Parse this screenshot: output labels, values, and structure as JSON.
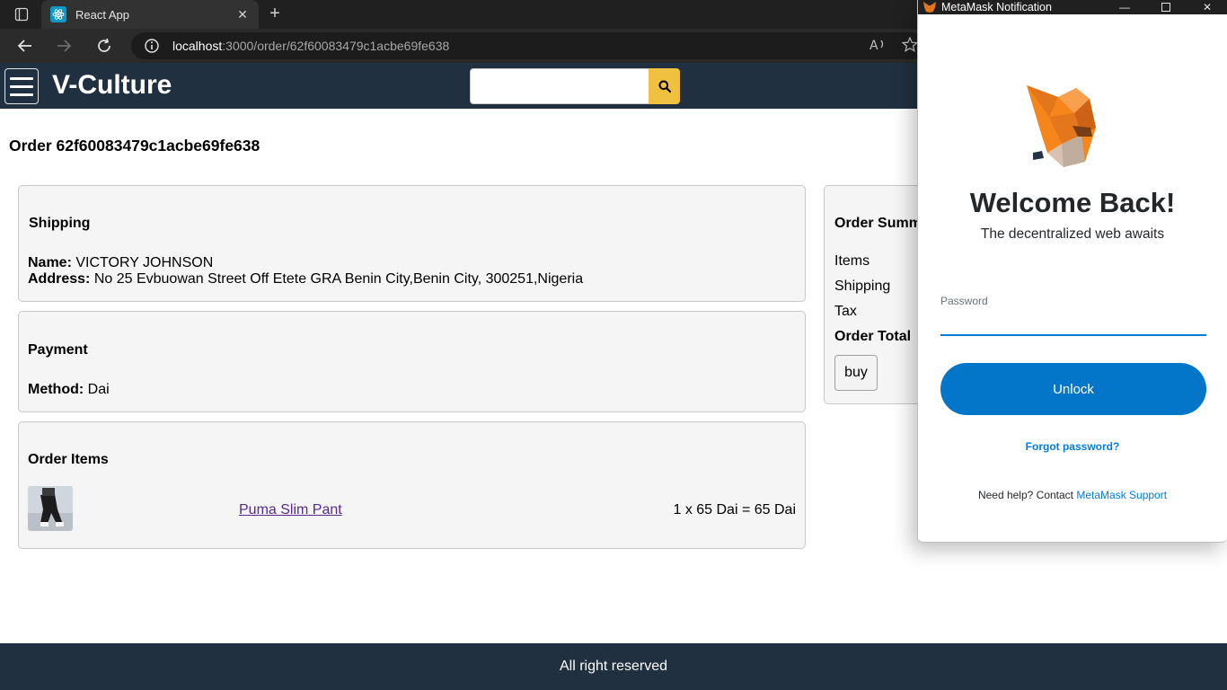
{
  "browser": {
    "tab_title": "React App",
    "url_host": "localhost",
    "url_path": ":3000/order/62f60083479c1acbe69fe638"
  },
  "header": {
    "brand": "V-Culture",
    "search_placeholder": ""
  },
  "order": {
    "title": "Order 62f60083479c1acbe69fe638",
    "shipping": {
      "heading": "Shipping",
      "name_label": "Name:",
      "name": "VICTORY JOHNSON",
      "address_label": "Address:",
      "address": "No 25 Evbuowan Street Off Etete GRA Benin City,Benin City, 300251,Nigeria"
    },
    "payment": {
      "heading": "Payment",
      "method_label": "Method:",
      "method": "Dai"
    },
    "items": {
      "heading": "Order Items",
      "list": [
        {
          "name": "Puma Slim Pant",
          "price_line": "1 x 65 Dai = 65 Dai"
        }
      ]
    },
    "summary": {
      "heading": "Order Summ",
      "rows": [
        "Items",
        "Shipping",
        "Tax"
      ],
      "total_label": "Order Total",
      "buy_label": "buy"
    }
  },
  "footer": {
    "text": "All right reserved"
  },
  "metamask": {
    "window_title": "MetaMask Notification",
    "welcome": "Welcome Back!",
    "subtitle": "The decentralized web awaits",
    "password_label": "Password",
    "unlock_label": "Unlock",
    "forgot_label": "Forgot password?",
    "help_prefix": "Need help? Contact ",
    "help_link": "MetaMask Support",
    "colors": {
      "primary": "#037dd6",
      "button": "#0376c9"
    }
  },
  "colors": {
    "app_header": "#203040",
    "search_button": "#f0c040",
    "card_bg": "#f5f5f5"
  }
}
